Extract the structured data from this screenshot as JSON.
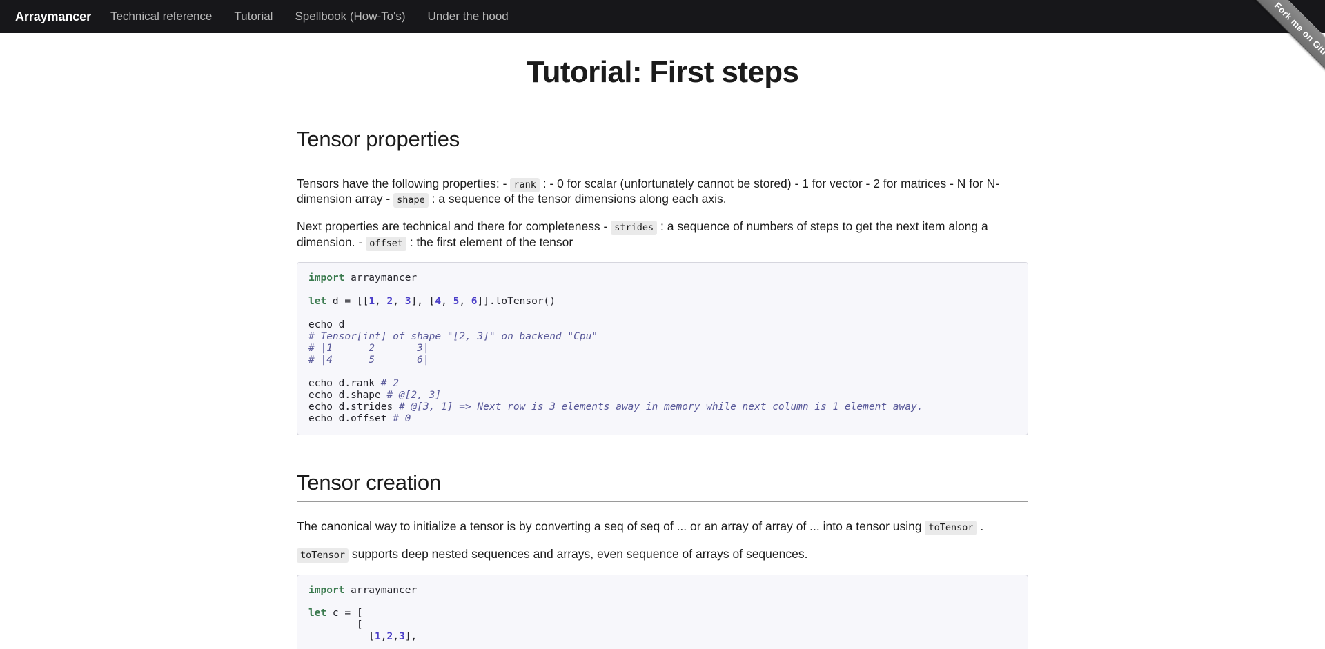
{
  "navbar": {
    "brand": "Arraymancer",
    "links": [
      {
        "label": "Technical reference"
      },
      {
        "label": "Tutorial"
      },
      {
        "label": "Spellbook (How-To's)"
      },
      {
        "label": "Under the hood"
      }
    ]
  },
  "ribbon": {
    "label": "Fork me on GitHub",
    "color": "#7a7a7a"
  },
  "page": {
    "title": "Tutorial: First steps"
  },
  "sections": [
    {
      "heading": "Tensor properties",
      "paragraphs": [
        {
          "parts": [
            {
              "type": "text",
              "value": "Tensors have the following properties: - "
            },
            {
              "type": "code",
              "value": "rank"
            },
            {
              "type": "text",
              "value": " : - 0 for scalar (unfortunately cannot be stored) - 1 for vector - 2 for matrices - N for N-dimension array - "
            },
            {
              "type": "code",
              "value": "shape"
            },
            {
              "type": "text",
              "value": " : a sequence of the tensor dimensions along each axis."
            }
          ]
        },
        {
          "parts": [
            {
              "type": "text",
              "value": "Next properties are technical and there for completeness - "
            },
            {
              "type": "code",
              "value": "strides"
            },
            {
              "type": "text",
              "value": " : a sequence of numbers of steps to get the next item along a dimension. - "
            },
            {
              "type": "code",
              "value": "offset"
            },
            {
              "type": "text",
              "value": " : the first element of the tensor"
            }
          ]
        }
      ],
      "code": {
        "language": "nim",
        "lines": [
          [
            {
              "t": "kw",
              "v": "import"
            },
            {
              "t": "pl",
              "v": " arraymancer"
            }
          ],
          [
            {
              "t": "pl",
              "v": ""
            }
          ],
          [
            {
              "t": "kw",
              "v": "let"
            },
            {
              "t": "pl",
              "v": " d = [["
            },
            {
              "t": "num",
              "v": "1"
            },
            {
              "t": "pl",
              "v": ", "
            },
            {
              "t": "num",
              "v": "2"
            },
            {
              "t": "pl",
              "v": ", "
            },
            {
              "t": "num",
              "v": "3"
            },
            {
              "t": "pl",
              "v": "], ["
            },
            {
              "t": "num",
              "v": "4"
            },
            {
              "t": "pl",
              "v": ", "
            },
            {
              "t": "num",
              "v": "5"
            },
            {
              "t": "pl",
              "v": ", "
            },
            {
              "t": "num",
              "v": "6"
            },
            {
              "t": "pl",
              "v": "]].toTensor()"
            }
          ],
          [
            {
              "t": "pl",
              "v": ""
            }
          ],
          [
            {
              "t": "pl",
              "v": "echo d"
            }
          ],
          [
            {
              "t": "com",
              "v": "# Tensor[int] of shape \"[2, 3]\" on backend \"Cpu\""
            }
          ],
          [
            {
              "t": "com",
              "v": "# |1      2       3|"
            }
          ],
          [
            {
              "t": "com",
              "v": "# |4      5       6|"
            }
          ],
          [
            {
              "t": "pl",
              "v": ""
            }
          ],
          [
            {
              "t": "pl",
              "v": "echo d.rank "
            },
            {
              "t": "com",
              "v": "# 2"
            }
          ],
          [
            {
              "t": "pl",
              "v": "echo d.shape "
            },
            {
              "t": "com",
              "v": "# @[2, 3]"
            }
          ],
          [
            {
              "t": "pl",
              "v": "echo d.strides "
            },
            {
              "t": "com",
              "v": "# @[3, 1] => Next row is 3 elements away in memory while next column is 1 element away."
            }
          ],
          [
            {
              "t": "pl",
              "v": "echo d.offset "
            },
            {
              "t": "com",
              "v": "# 0"
            }
          ]
        ]
      }
    },
    {
      "heading": "Tensor creation",
      "paragraphs": [
        {
          "parts": [
            {
              "type": "text",
              "value": "The canonical way to initialize a tensor is by converting a seq of seq of ... or an array of array of ... into a tensor using "
            },
            {
              "type": "code",
              "value": "toTensor"
            },
            {
              "type": "text",
              "value": " ."
            }
          ]
        },
        {
          "parts": [
            {
              "type": "code",
              "value": "toTensor"
            },
            {
              "type": "text",
              "value": " supports deep nested sequences and arrays, even sequence of arrays of sequences."
            }
          ]
        }
      ],
      "code": {
        "language": "nim",
        "lines": [
          [
            {
              "t": "kw",
              "v": "import"
            },
            {
              "t": "pl",
              "v": " arraymancer"
            }
          ],
          [
            {
              "t": "pl",
              "v": ""
            }
          ],
          [
            {
              "t": "kw",
              "v": "let"
            },
            {
              "t": "pl",
              "v": " c = ["
            }
          ],
          [
            {
              "t": "pl",
              "v": "        ["
            }
          ],
          [
            {
              "t": "pl",
              "v": "          ["
            },
            {
              "t": "num",
              "v": "1"
            },
            {
              "t": "pl",
              "v": ","
            },
            {
              "t": "num",
              "v": "2"
            },
            {
              "t": "pl",
              "v": ","
            },
            {
              "t": "num",
              "v": "3"
            },
            {
              "t": "pl",
              "v": "],"
            }
          ]
        ]
      }
    }
  ]
}
